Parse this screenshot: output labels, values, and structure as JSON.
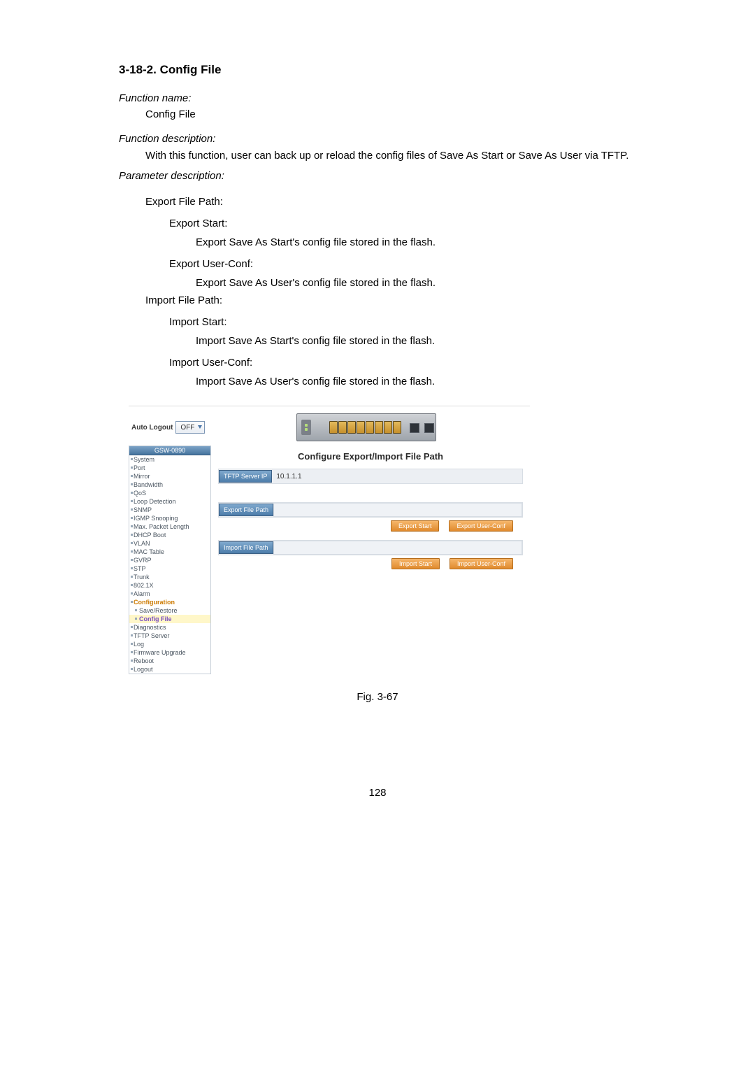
{
  "doc": {
    "section_title": "3-18-2. Config File",
    "fn_name_label": "Function name:",
    "fn_name": "Config File",
    "fn_desc_label": "Function description:",
    "fn_desc": "With this function, user can back up or reload the config files of Save As Start or Save As User via TFTP.",
    "param_label": "Parameter description:",
    "export_path": "Export File Path:",
    "export_start": "Export Start:",
    "export_start_desc": "Export Save As Start's config file stored in the flash.",
    "export_user": "Export User-Conf:",
    "export_user_desc": "Export Save As User's config file stored in the flash.",
    "import_path": "Import File Path:",
    "import_start": "Import Start:",
    "import_start_desc": "Import Save As Start's config file stored in the flash.",
    "import_user": "Import User-Conf:",
    "import_user_desc": "Import Save As User's config file stored in the flash.",
    "fig_caption": "Fig. 3-67",
    "page_number": "128"
  },
  "shot": {
    "auto_logout_label": "Auto Logout",
    "auto_logout_value": "OFF",
    "device_model": "GSW-0890",
    "sidebar": [
      "System",
      "Port",
      "Mirror",
      "Bandwidth",
      "QoS",
      "Loop Detection",
      "SNMP",
      "IGMP Snooping",
      "Max. Packet Length",
      "DHCP Boot",
      "VLAN",
      "MAC Table",
      "GVRP",
      "STP",
      "Trunk",
      "802.1X",
      "Alarm"
    ],
    "sidebar_config_parent": "Configuration",
    "sidebar_config_children": [
      "Save/Restore",
      "Config File"
    ],
    "sidebar_after": [
      "Diagnostics",
      "TFTP Server",
      "Log",
      "Firmware Upgrade",
      "Reboot",
      "Logout"
    ],
    "main_title": "Configure Export/Import File Path",
    "tftp_label": "TFTP Server IP",
    "tftp_value": "10.1.1.1",
    "export_path_label": "Export File Path",
    "export_start_btn": "Export Start",
    "export_user_btn": "Export User-Conf",
    "import_path_label": "Import File Path",
    "import_start_btn": "Import Start",
    "import_user_btn": "Import User-Conf"
  }
}
